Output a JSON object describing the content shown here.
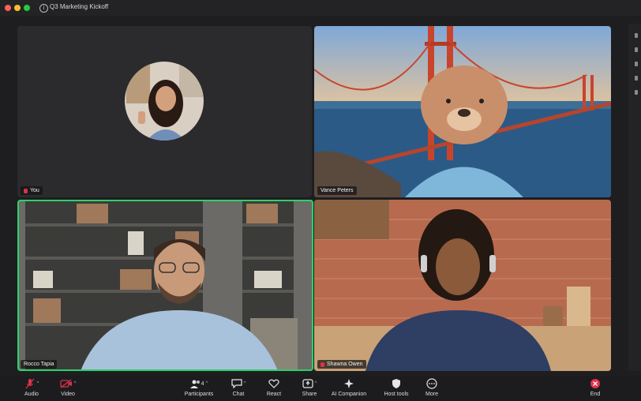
{
  "window": {
    "title": "Q3 Marketing Kickoff"
  },
  "participants": {
    "self": {
      "name": "You"
    },
    "tile2": {
      "name": "Vance Peters"
    },
    "tile3": {
      "name": "Rocco Tapia"
    },
    "tile4": {
      "name": "Shawna Owen"
    }
  },
  "toolbar": {
    "audio": "Audio",
    "video": "Video",
    "participants": "Participants",
    "participants_count": "4",
    "chat": "Chat",
    "react": "React",
    "share": "Share",
    "ai_companion": "AI Companion",
    "host_tools": "Host tools",
    "more": "More",
    "end": "End"
  },
  "colors": {
    "speaking_outline": "#2bd16b",
    "end_red": "#e0314b",
    "muted_red": "#e0314b"
  }
}
